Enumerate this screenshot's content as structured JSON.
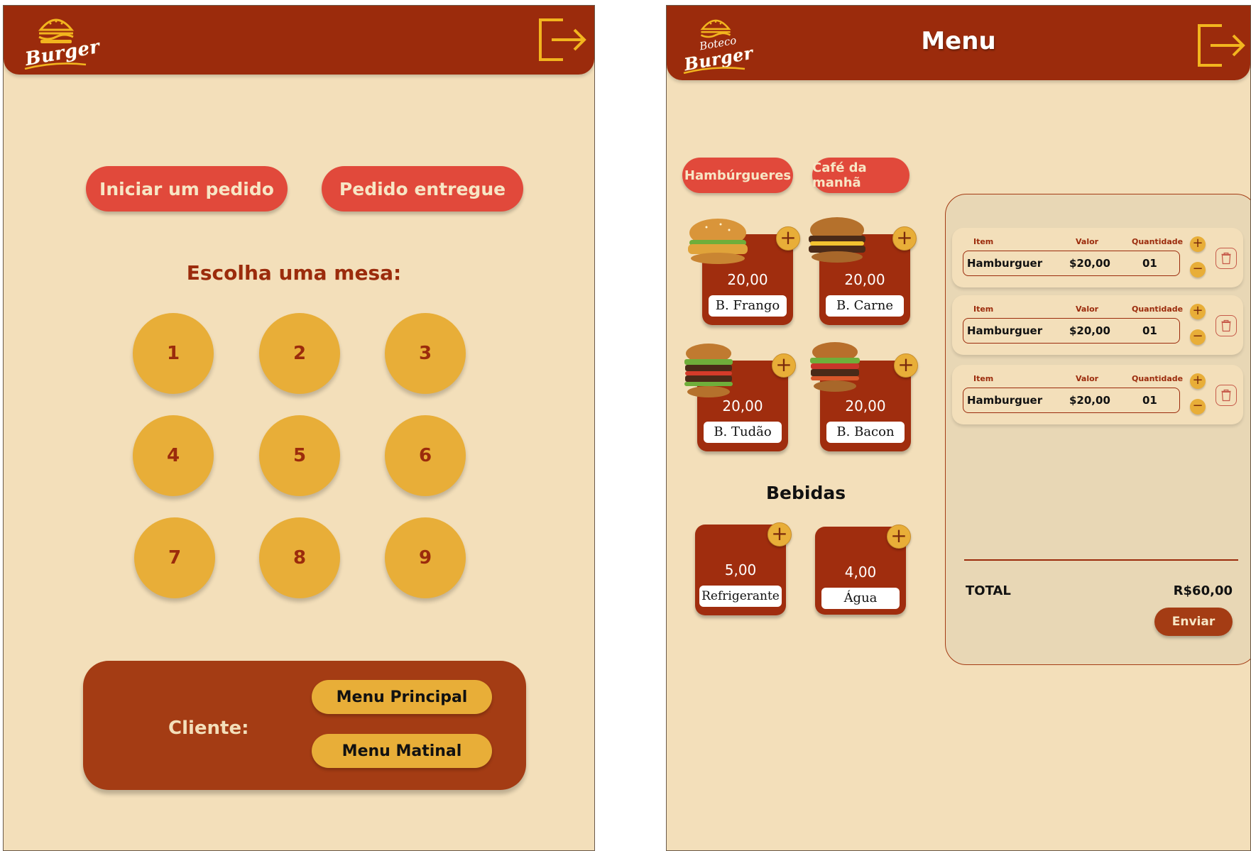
{
  "colors": {
    "header": "#9b2b0c",
    "background": "#f3dfba",
    "primary_button": "#e1493b",
    "table_button": "#e8ae38",
    "accent_icon": "#f2b51e"
  },
  "left_screen": {
    "logo_text": "Burger",
    "exit_icon": "exit-icon",
    "start_order_label": "Iniciar um pedido",
    "delivered_order_label": "Pedido entregue",
    "choose_table_title": "Escolha uma mesa:",
    "tables": [
      "1",
      "2",
      "3",
      "4",
      "5",
      "6",
      "7",
      "8",
      "9"
    ],
    "client_label": "Cliente:",
    "main_menu_label": "Menu Principal",
    "morning_menu_label": "Menu Matinal"
  },
  "right_screen": {
    "logo_top_text": "Boteco",
    "logo_text": "Burger",
    "title": "Menu",
    "exit_icon": "exit-icon",
    "categories": [
      "Hambúrgueres",
      "Café da manhã"
    ],
    "burgers": [
      {
        "price": "20,00",
        "name": "B. Frango"
      },
      {
        "price": "20,00",
        "name": "B. Carne"
      },
      {
        "price": "20,00",
        "name": "B. Tudão"
      },
      {
        "price": "20,00",
        "name": "B. Bacon"
      }
    ],
    "drinks_title": "Bebidas",
    "drinks": [
      {
        "price": "5,00",
        "name": "Refrigerante"
      },
      {
        "price": "4,00",
        "name": "Água"
      }
    ],
    "order": {
      "headers": {
        "item": "Item",
        "value": "Valor",
        "quantity": "Quantidade"
      },
      "items": [
        {
          "item": "Hamburguer",
          "value": "$20,00",
          "quantity": "01"
        },
        {
          "item": "Hamburguer",
          "value": "$20,00",
          "quantity": "01"
        },
        {
          "item": "Hamburguer",
          "value": "$20,00",
          "quantity": "01"
        }
      ],
      "total_label": "TOTAL",
      "total_value": "R$60,00",
      "send_label": "Enviar"
    }
  }
}
